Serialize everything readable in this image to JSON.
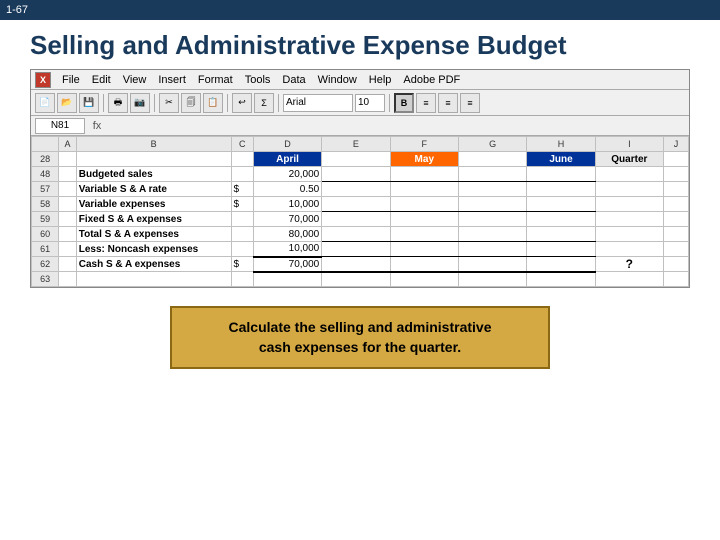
{
  "topbar": {
    "slide_number": "1-67"
  },
  "header": {
    "title": "Selling and Administrative Expense Budget"
  },
  "excel": {
    "cell_ref": "N81",
    "menu_items": [
      "File",
      "Edit",
      "View",
      "Insert",
      "Format",
      "Tools",
      "Data",
      "Window",
      "Help",
      "Adobe PDF"
    ],
    "font": "Arial",
    "size": "10",
    "column_headers": [
      "A",
      "B",
      "C",
      "D",
      "E",
      "F",
      "G",
      "H",
      "I",
      "J"
    ],
    "month_headers": {
      "april": "April",
      "may": "May",
      "june": "June",
      "quarter": "Quarter"
    },
    "rows": [
      {
        "row_num": "28",
        "label": "",
        "col_c": "",
        "col_d": "",
        "col_e": "",
        "col_f": "",
        "col_g": "",
        "col_h": "",
        "col_i": ""
      },
      {
        "row_num": "48",
        "label": "Budgeted sales",
        "col_c": "",
        "col_d": "20,000",
        "col_e": "",
        "col_f": "",
        "col_g": "",
        "col_h": "",
        "col_i": ""
      },
      {
        "row_num": "57",
        "label": "Variable S & A rate",
        "prefix": "$",
        "col_d": "0.50",
        "col_e": "",
        "col_f": "",
        "col_g": "",
        "col_h": "",
        "col_i": ""
      },
      {
        "row_num": "58",
        "label": "Variable expenses",
        "prefix": "$",
        "col_d": "10,000",
        "col_e": "",
        "col_f": "",
        "col_g": "",
        "col_h": "",
        "col_i": ""
      },
      {
        "row_num": "59",
        "label": "Fixed S & A expenses",
        "col_c": "",
        "col_d": "70,000",
        "col_e": "",
        "col_f": "",
        "col_g": "",
        "col_h": "",
        "col_i": ""
      },
      {
        "row_num": "60",
        "label": "Total S & A expenses",
        "col_c": "",
        "col_d": "80,000",
        "col_e": "",
        "col_f": "",
        "col_g": "",
        "col_h": "",
        "col_i": ""
      },
      {
        "row_num": "61",
        "label": "Less: Noncash expenses",
        "col_c": "",
        "col_d": "10,000",
        "col_e": "",
        "col_f": "",
        "col_g": "",
        "col_h": "",
        "col_i": ""
      },
      {
        "row_num": "62",
        "label": "Cash S & A expenses",
        "prefix": "$",
        "col_d": "70,000",
        "col_e": "",
        "col_f": "",
        "col_g": "",
        "col_h": "",
        "col_i": "?"
      },
      {
        "row_num": "63",
        "label": "",
        "col_c": "",
        "col_d": "",
        "col_e": "",
        "col_f": "",
        "col_g": "",
        "col_h": "",
        "col_i": ""
      }
    ]
  },
  "callout": {
    "line1": "Calculate the selling and administrative",
    "line2": "cash expenses for the quarter."
  }
}
